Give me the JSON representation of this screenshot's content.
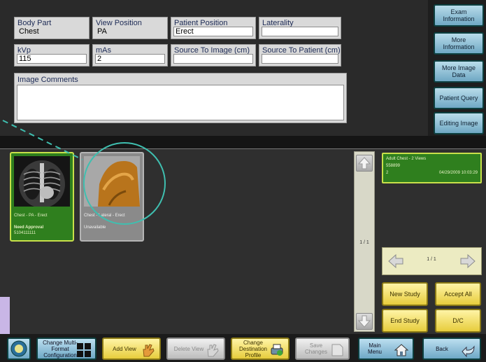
{
  "fields": {
    "body_part": {
      "label": "Body Part",
      "value": "Chest"
    },
    "view_position": {
      "label": "View Position",
      "value": "PA"
    },
    "patient_position": {
      "label": "Patient Position",
      "value": "Erect"
    },
    "laterality": {
      "label": "Laterality",
      "value": ""
    },
    "kvp": {
      "label": "kVp",
      "value": "115"
    },
    "mas": {
      "label": "mAs",
      "value": "2"
    },
    "source_to_image": {
      "label": "Source To Image (cm)",
      "value": ""
    },
    "source_to_patient": {
      "label": "Source To Patient (cm)",
      "value": ""
    },
    "image_comments": {
      "label": "Image Comments",
      "value": ""
    }
  },
  "side_buttons": {
    "exam_information": "Exam Information",
    "more_information": "More Information",
    "more_image_data": "More Image Data",
    "patient_query": "Patient Query",
    "editing_image": "Editing Image"
  },
  "thumbnails": [
    {
      "caption": "Chest - PA - Erect",
      "status": "Need Approval",
      "id": "5104111111"
    },
    {
      "caption": "Chest - Lateral - Erect",
      "status": "Unavailable"
    }
  ],
  "pager": {
    "text": "1 / 1"
  },
  "study": {
    "title": "Adult Chest - 2 Views",
    "id": "558899",
    "count": "2",
    "date": "04/29/2009 10:03:29",
    "nav_text": "1 / 1"
  },
  "study_buttons": {
    "new_study": "New Study",
    "accept_all": "Accept All",
    "end_study": "End Study",
    "dc": "D/C"
  },
  "toolbar": {
    "change_multiformat": "Change Multi-Format Configuration",
    "add_view": "Add View",
    "delete_view": "Delete View",
    "change_destination": "Change Destination Profile",
    "save_changes": "Save Changes",
    "main_menu": "Main Menu",
    "back": "Back"
  },
  "colors": {
    "accent_green": "#2f7f1e",
    "highlight": "#c8e04a",
    "annotation": "#3fbfb0"
  }
}
